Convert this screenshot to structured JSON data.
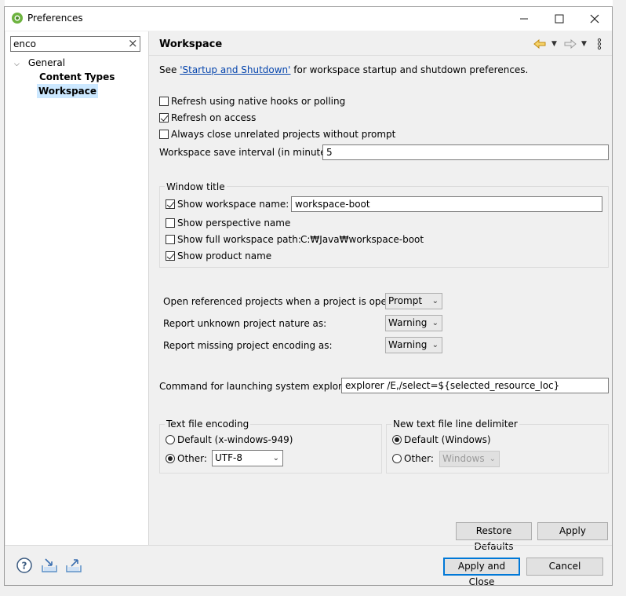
{
  "window": {
    "title": "Preferences"
  },
  "filter": {
    "value": "enco",
    "clear_glyph": "×"
  },
  "tree": {
    "general": "General",
    "content_types": "Content Types",
    "workspace": "Workspace"
  },
  "page": {
    "title": "Workspace",
    "see_prefix": "See ",
    "see_link": "'Startup and Shutdown'",
    "see_suffix": " for workspace startup and shutdown preferences."
  },
  "options": {
    "refresh_native": {
      "label": "Refresh using native hooks or polling",
      "checked": false
    },
    "refresh_access": {
      "label": "Refresh on access",
      "checked": true
    },
    "always_close": {
      "label": "Always close unrelated projects without prompt",
      "checked": false
    },
    "save_interval_label": "Workspace save interval (in minutes):",
    "save_interval_value": "5"
  },
  "window_title": {
    "legend": "Window title",
    "show_ws_name": {
      "label": "Show workspace name:",
      "checked": true,
      "value": "workspace-boot"
    },
    "show_perspective": {
      "label": "Show perspective name",
      "checked": false
    },
    "show_full_path": {
      "label": "Show full workspace path:",
      "checked": false,
      "value": "C:₩Java₩workspace-boot"
    },
    "show_product": {
      "label": "Show product name",
      "checked": true
    }
  },
  "projects": {
    "open_ref_label": "Open referenced projects when a project is opened:",
    "open_ref_value": "Prompt",
    "unknown_nature_label": "Report unknown project nature as:",
    "unknown_nature_value": "Warning",
    "missing_encoding_label": "Report missing project encoding as:",
    "missing_encoding_value": "Warning"
  },
  "explorer": {
    "label": "Command for launching system explorer:",
    "value": "explorer /E,/select=${selected_resource_loc}"
  },
  "encoding": {
    "legend": "Text file encoding",
    "default_label": "Default (x-windows-949)",
    "default_selected": false,
    "other_label": "Other:",
    "other_selected": true,
    "other_value": "UTF-8"
  },
  "delimiter": {
    "legend": "New text file line delimiter",
    "default_label": "Default (Windows)",
    "default_selected": true,
    "other_label": "Other:",
    "other_selected": false,
    "other_value": "Windows"
  },
  "buttons": {
    "restore_defaults": "Restore Defaults",
    "apply": "Apply",
    "apply_close": "Apply and Close",
    "cancel": "Cancel"
  },
  "icons": {
    "app": "eclipse-preferences-icon",
    "back": "back-arrow-icon",
    "forward": "forward-arrow-icon",
    "menu": "view-menu-icon",
    "help": "help-icon",
    "import": "import-icon",
    "export": "export-icon"
  },
  "colors": {
    "accent": "#0078d7",
    "link": "#0645ad",
    "selection": "#cce8ff",
    "back_arrow": "#e0a020"
  }
}
